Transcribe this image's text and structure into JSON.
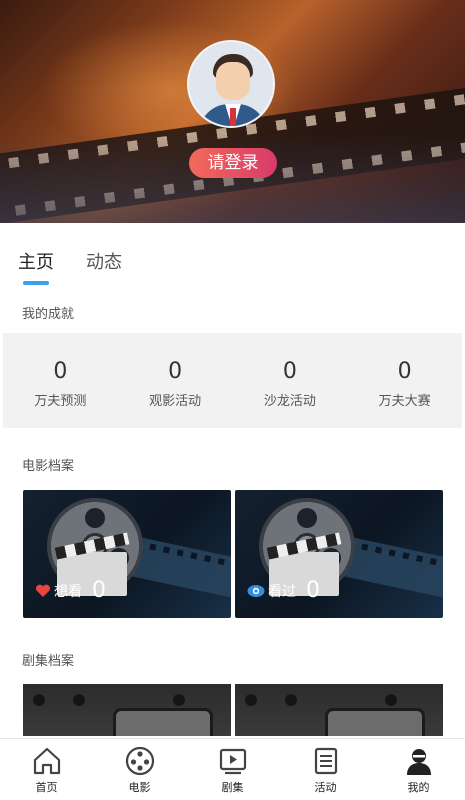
{
  "profile": {
    "login_label": "请登录"
  },
  "tabs": [
    {
      "label": "主页",
      "active": true
    },
    {
      "label": "动态",
      "active": false
    }
  ],
  "achievements": {
    "title": "我的成就",
    "items": [
      {
        "count": "0",
        "label": "万夫预测"
      },
      {
        "count": "0",
        "label": "观影活动"
      },
      {
        "count": "0",
        "label": "沙龙活动"
      },
      {
        "count": "0",
        "label": "万夫大赛"
      }
    ]
  },
  "movie_archive": {
    "title": "电影档案",
    "cards": [
      {
        "icon": "heart-icon",
        "label": "想看",
        "count": "0"
      },
      {
        "icon": "eye-icon",
        "label": "看过",
        "count": "0"
      }
    ]
  },
  "series_archive": {
    "title": "剧集档案"
  },
  "bottom_nav": [
    {
      "icon": "home-icon",
      "label": "首页"
    },
    {
      "icon": "film-reel-icon",
      "label": "电影"
    },
    {
      "icon": "play-icon",
      "label": "剧集"
    },
    {
      "icon": "list-icon",
      "label": "活动"
    },
    {
      "icon": "user-icon",
      "label": "我的"
    }
  ],
  "colors": {
    "accent": "#3aa0f0",
    "login_gradient_start": "#f26a5a",
    "login_gradient_end": "#d83a6a",
    "heart": "#e8453c",
    "eye": "#2f8ee0"
  }
}
